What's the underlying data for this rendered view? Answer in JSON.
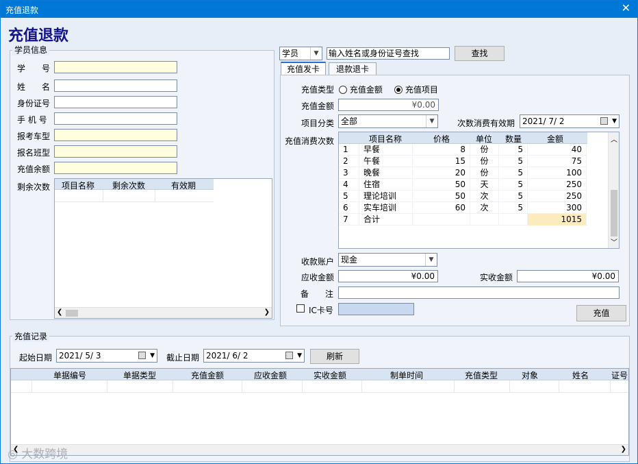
{
  "window": {
    "title": "充值退款",
    "close": "✕"
  },
  "page_title": "充值退款",
  "student_info": {
    "group_label": "学员信息",
    "fields": [
      {
        "label": "学　　号",
        "value": ""
      },
      {
        "label": "姓　　名",
        "value": ""
      },
      {
        "label": "身份证号",
        "value": ""
      },
      {
        "label": "手 机 号",
        "value": ""
      },
      {
        "label": "报考车型",
        "value": ""
      },
      {
        "label": "报名班型",
        "value": ""
      },
      {
        "label": "充值余额",
        "value": ""
      }
    ],
    "remaining_label": "剩余次数",
    "remaining_columns": [
      "项目名称",
      "剩余次数",
      "有效期"
    ]
  },
  "search": {
    "type_value": "学员",
    "input_value": "输入姓名或身份证号查找",
    "button": "查找"
  },
  "tabs": [
    {
      "label": "充值发卡",
      "active": true
    },
    {
      "label": "退款退卡",
      "active": false
    }
  ],
  "recharge": {
    "type_label": "充值类型",
    "options": [
      {
        "label": "充值金额",
        "checked": false
      },
      {
        "label": "充值项目",
        "checked": true
      }
    ],
    "amount_label": "充值金额",
    "amount_value": "¥0.00",
    "category_label": "项目分类",
    "category_value": "全部",
    "expiry_label": "次数消费有效期",
    "expiry_value": "2021/ 7/ 2",
    "times_label": "充值消费次数",
    "columns": [
      "项目名称",
      "价格",
      "单位",
      "数量",
      "金额"
    ],
    "rows": [
      {
        "no": "1",
        "name": "早餐",
        "price": "8",
        "unit": "份",
        "qty": "5",
        "amount": "40"
      },
      {
        "no": "2",
        "name": "午餐",
        "price": "15",
        "unit": "份",
        "qty": "5",
        "amount": "75"
      },
      {
        "no": "3",
        "name": "晚餐",
        "price": "20",
        "unit": "份",
        "qty": "5",
        "amount": "100"
      },
      {
        "no": "4",
        "name": "住宿",
        "price": "50",
        "unit": "天",
        "qty": "5",
        "amount": "250"
      },
      {
        "no": "5",
        "name": "理论培训",
        "price": "50",
        "unit": "次",
        "qty": "5",
        "amount": "250"
      },
      {
        "no": "6",
        "name": "实车培训",
        "price": "60",
        "unit": "次",
        "qty": "5",
        "amount": "300"
      },
      {
        "no": "7",
        "name": "合计",
        "price": "",
        "unit": "",
        "qty": "",
        "amount": "1015"
      }
    ],
    "account_label": "收款账户",
    "account_value": "现金",
    "receivable_label": "应收金额",
    "receivable_value": "¥0.00",
    "received_label": "实收金额",
    "received_value": "¥0.00",
    "remark_label": "备　　注",
    "remark_value": "",
    "ic_label": "IC卡号",
    "ic_value": "",
    "submit": "充值"
  },
  "records": {
    "group_label": "充值记录",
    "start_label": "起始日期",
    "start_value": "2021/ 5/ 3",
    "end_label": "截止日期",
    "end_value": "2021/ 6/ 2",
    "refresh": "刷新",
    "columns": [
      "单据编号",
      "单据类型",
      "充值金额",
      "应收金额",
      "实收金额",
      "制单时间",
      "充值类型",
      "对象",
      "姓名",
      "证号"
    ]
  },
  "watermark": "大数跨境"
}
